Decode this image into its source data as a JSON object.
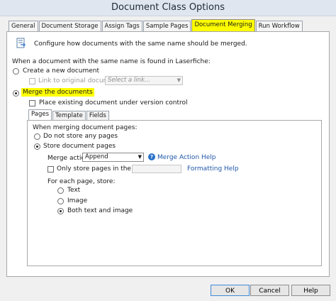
{
  "window": {
    "title": "Document Class Options"
  },
  "tabs": [
    {
      "label": "General"
    },
    {
      "label": "Document Storage"
    },
    {
      "label": "Assign Tags"
    },
    {
      "label": "Sample Pages"
    },
    {
      "label": "Document Merging"
    },
    {
      "label": "Run Workflow"
    }
  ],
  "active_tab": "Document Merging",
  "header": {
    "description": "Configure how documents with the same name should be merged."
  },
  "section": {
    "question": "When a document with the same name is found in Laserfiche:"
  },
  "create_new": {
    "label": "Create a new document",
    "selected": false
  },
  "link_original": {
    "label": "Link to original document",
    "checked": false,
    "disabled": true
  },
  "link_select": {
    "placeholder": "Select a link...",
    "disabled": true
  },
  "merge": {
    "label": "Merge the documents",
    "selected": true
  },
  "place_existing": {
    "label": "Place existing document under version control",
    "checked": false
  },
  "inner_tabs": [
    {
      "label": "Pages"
    },
    {
      "label": "Template"
    },
    {
      "label": "Fields"
    }
  ],
  "pages": {
    "heading": "When merging document pages:",
    "not_store": {
      "label": "Do not store any pages",
      "selected": false
    },
    "store": {
      "label": "Store document pages",
      "selected": true
    },
    "merge_action_label": "Merge action:",
    "merge_action_value": "Append",
    "merge_action_help": "Merge Action Help",
    "only_store": {
      "label": "Only store pages in the range:",
      "checked": false
    },
    "formatting_help": "Formatting Help",
    "for_each_label": "For each page, store:",
    "text_option": {
      "label": "Text",
      "selected": false
    },
    "image_option": {
      "label": "Image",
      "selected": false
    },
    "both_option": {
      "label": "Both text and image",
      "selected": true
    }
  },
  "buttons": {
    "ok": "OK",
    "cancel": "Cancel",
    "help": "Help"
  },
  "colors": {
    "highlight": "#ffff00",
    "link": "#1f57a8",
    "title_bar": "#dfe6ef"
  }
}
